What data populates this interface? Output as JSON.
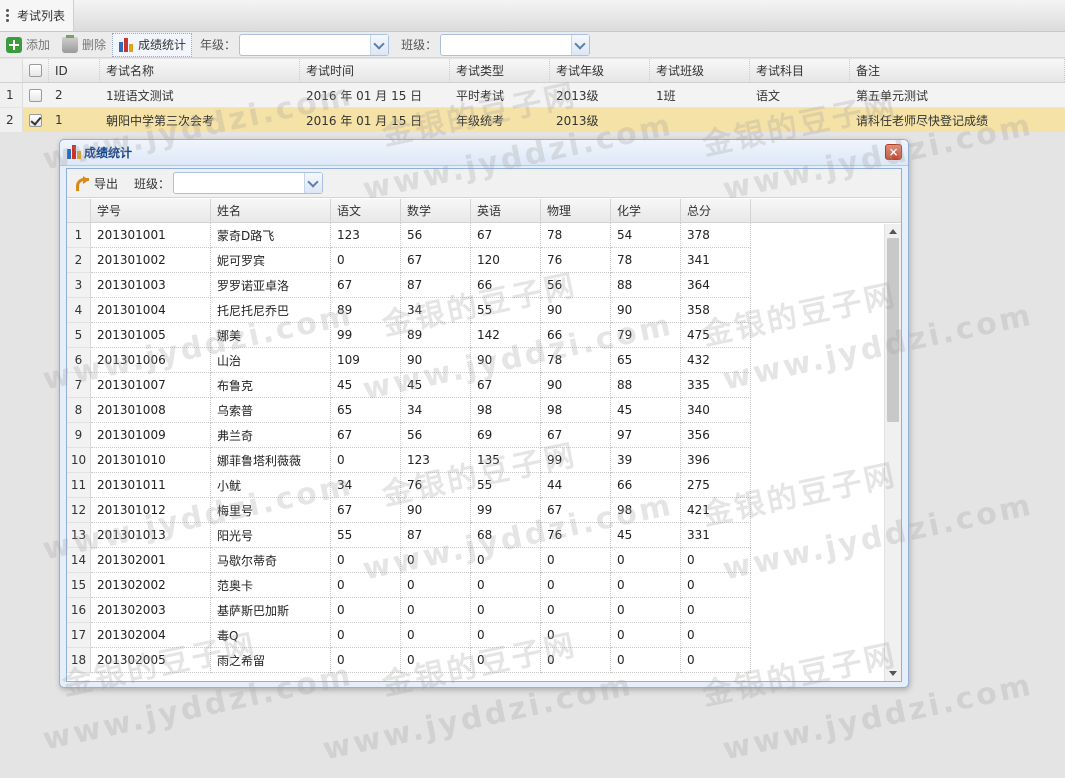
{
  "tab": {
    "title": "考试列表"
  },
  "toolbar": {
    "add_label": "添加",
    "delete_label": "删除",
    "stats_label": "成绩统计",
    "grade_label": "年级：",
    "grade_value": "",
    "class_label": "班级：",
    "class_value": ""
  },
  "exam_grid": {
    "columns": [
      "ID",
      "考试名称",
      "考试时间",
      "考试类型",
      "考试年级",
      "考试班级",
      "考试科目",
      "备注"
    ],
    "rows": [
      {
        "rownum": "1",
        "checked": false,
        "cells": [
          "2",
          "1班语文测试",
          "2016 年 01 月 15 日",
          "平时考试",
          "2013级",
          "1班",
          "语文",
          "第五单元测试"
        ]
      },
      {
        "rownum": "2",
        "checked": true,
        "cells": [
          "1",
          "朝阳中学第三次会考",
          "2016 年 01 月 15 日",
          "年级统考",
          "2013级",
          "",
          "",
          "请科任老师尽快登记成绩"
        ]
      }
    ]
  },
  "dialog": {
    "title": "成绩统计",
    "close_glyph": "×",
    "export_label": "导出",
    "class_label": "班级：",
    "class_value": "",
    "columns": [
      "学号",
      "姓名",
      "语文",
      "数学",
      "英语",
      "物理",
      "化学",
      "总分"
    ],
    "rows": [
      [
        "1",
        "201301001",
        "蒙奇D路飞",
        "123",
        "56",
        "67",
        "78",
        "54",
        "378"
      ],
      [
        "2",
        "201301002",
        "妮可罗宾",
        "0",
        "67",
        "120",
        "76",
        "78",
        "341"
      ],
      [
        "3",
        "201301003",
        "罗罗诺亚卓洛",
        "67",
        "87",
        "66",
        "56",
        "88",
        "364"
      ],
      [
        "4",
        "201301004",
        "托尼托尼乔巴",
        "89",
        "34",
        "55",
        "90",
        "90",
        "358"
      ],
      [
        "5",
        "201301005",
        "娜美",
        "99",
        "89",
        "142",
        "66",
        "79",
        "475"
      ],
      [
        "6",
        "201301006",
        "山治",
        "109",
        "90",
        "90",
        "78",
        "65",
        "432"
      ],
      [
        "7",
        "201301007",
        "布鲁克",
        "45",
        "45",
        "67",
        "90",
        "88",
        "335"
      ],
      [
        "8",
        "201301008",
        "乌索普",
        "65",
        "34",
        "98",
        "98",
        "45",
        "340"
      ],
      [
        "9",
        "201301009",
        "弗兰奇",
        "67",
        "56",
        "69",
        "67",
        "97",
        "356"
      ],
      [
        "10",
        "201301010",
        "娜菲鲁塔利薇薇",
        "0",
        "123",
        "135",
        "99",
        "39",
        "396"
      ],
      [
        "11",
        "201301011",
        "小鱿",
        "34",
        "76",
        "55",
        "44",
        "66",
        "275"
      ],
      [
        "12",
        "201301012",
        "梅里号",
        "67",
        "90",
        "99",
        "67",
        "98",
        "421"
      ],
      [
        "13",
        "201301013",
        "阳光号",
        "55",
        "87",
        "68",
        "76",
        "45",
        "331"
      ],
      [
        "14",
        "201302001",
        "马歇尔蒂奇",
        "0",
        "0",
        "0",
        "0",
        "0",
        "0"
      ],
      [
        "15",
        "201302002",
        "范奥卡",
        "0",
        "0",
        "0",
        "0",
        "0",
        "0"
      ],
      [
        "16",
        "201302003",
        "基萨斯巴加斯",
        "0",
        "0",
        "0",
        "0",
        "0",
        "0"
      ],
      [
        "17",
        "201302004",
        "毒Q",
        "0",
        "0",
        "0",
        "0",
        "0",
        "0"
      ],
      [
        "18",
        "201302005",
        "雨之希留",
        "0",
        "0",
        "0",
        "0",
        "0",
        "0"
      ]
    ]
  },
  "watermark": {
    "text_cn": "金银的豆子网",
    "text_url": "www.jyddzi.com"
  }
}
